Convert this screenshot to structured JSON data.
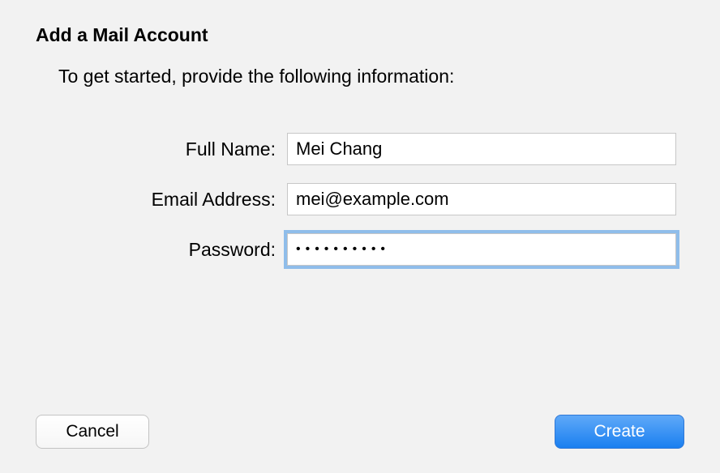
{
  "dialog": {
    "title": "Add a Mail Account",
    "subtitle": "To get started, provide the following information:"
  },
  "form": {
    "fullName": {
      "label": "Full Name:",
      "value": "Mei Chang"
    },
    "email": {
      "label": "Email Address:",
      "value": "mei@example.com"
    },
    "password": {
      "label": "Password:",
      "value": "••••••••••"
    }
  },
  "buttons": {
    "cancel": "Cancel",
    "create": "Create"
  }
}
